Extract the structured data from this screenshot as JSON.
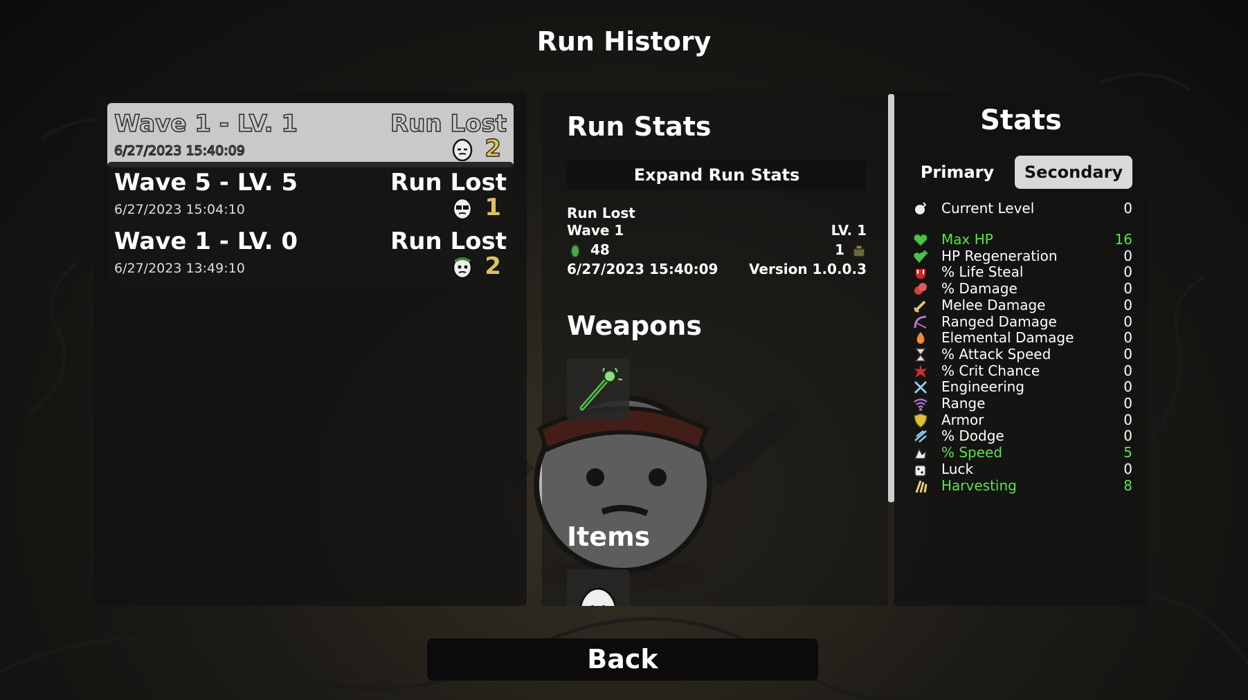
{
  "screen_title": "Run History",
  "runs": [
    {
      "wave_label": "Wave 1 - LV. 1",
      "result": "Run Lost",
      "date": "6/27/2023 15:40:09",
      "danger": "2",
      "character_icon": "potato-character-icon"
    },
    {
      "wave_label": "Wave 5 - LV. 5",
      "result": "Run Lost",
      "date": "6/27/2023 15:04:10",
      "danger": "1",
      "character_icon": "potato-character-icon"
    },
    {
      "wave_label": "Wave 1 - LV. 0",
      "result": "Run Lost",
      "date": "6/27/2023 13:49:10",
      "danger": "2",
      "character_icon": "potato-character-icon"
    }
  ],
  "run_stats": {
    "heading": "Run Stats",
    "expand_label": "Expand Run Stats",
    "result": "Run Lost",
    "wave": "Wave 1",
    "level": "LV. 1",
    "materials": "48",
    "crates": "1",
    "date": "6/27/2023 15:40:09",
    "version": "Version 1.0.0.3"
  },
  "weapons_heading": "Weapons",
  "items_heading": "Items",
  "stats_panel": {
    "title": "Stats",
    "tab_primary": "Primary",
    "tab_secondary": "Secondary",
    "current_level": {
      "name": "Current Level",
      "value": "0"
    },
    "rows": [
      {
        "name": "Max HP",
        "value": "16",
        "icon": "heart-icon",
        "positive": true
      },
      {
        "name": "HP Regeneration",
        "value": "0",
        "icon": "regen-icon",
        "positive": false
      },
      {
        "name": "% Life Steal",
        "value": "0",
        "icon": "life-steal-icon",
        "positive": false
      },
      {
        "name": "% Damage",
        "value": "0",
        "icon": "damage-icon",
        "positive": false
      },
      {
        "name": "Melee Damage",
        "value": "0",
        "icon": "melee-icon",
        "positive": false
      },
      {
        "name": "Ranged Damage",
        "value": "0",
        "icon": "ranged-icon",
        "positive": false
      },
      {
        "name": "Elemental Damage",
        "value": "0",
        "icon": "elemental-icon",
        "positive": false
      },
      {
        "name": "% Attack Speed",
        "value": "0",
        "icon": "attack-speed-icon",
        "positive": false
      },
      {
        "name": "% Crit Chance",
        "value": "0",
        "icon": "crit-icon",
        "positive": false
      },
      {
        "name": "Engineering",
        "value": "0",
        "icon": "engineering-icon",
        "positive": false
      },
      {
        "name": "Range",
        "value": "0",
        "icon": "range-icon",
        "positive": false
      },
      {
        "name": "Armor",
        "value": "0",
        "icon": "armor-icon",
        "positive": false
      },
      {
        "name": "% Dodge",
        "value": "0",
        "icon": "dodge-icon",
        "positive": false
      },
      {
        "name": "% Speed",
        "value": "5",
        "icon": "speed-icon",
        "positive": true
      },
      {
        "name": "Luck",
        "value": "0",
        "icon": "luck-icon",
        "positive": false
      },
      {
        "name": "Harvesting",
        "value": "8",
        "icon": "harvesting-icon",
        "positive": true
      }
    ]
  },
  "back_label": "Back",
  "colors": {
    "positive_stat": "#5be34b",
    "danger_gold": "#e0c060",
    "selected_row": "#c9c9c9"
  }
}
